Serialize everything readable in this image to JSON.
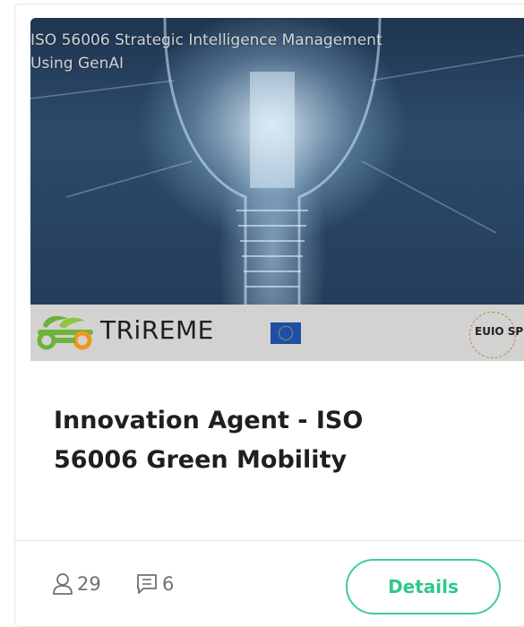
{
  "card": {
    "banner_title": "ISO 56006 Strategic Intelligence Management\nUsing GenAI",
    "logo_text": "TRiREME",
    "seal_text": "EUIO SPI",
    "title": "Innovation Agent - ISO\n56006 Green Mobility",
    "participants": "29",
    "comments": "6",
    "details_label": "Details"
  },
  "colors": {
    "accent": "#3ecf94",
    "logo_green": "#6bb33a",
    "text_dark": "#1f1f1f",
    "text_muted": "#707070"
  },
  "icons": {
    "participants": "user-icon",
    "comments": "comment-icon"
  }
}
